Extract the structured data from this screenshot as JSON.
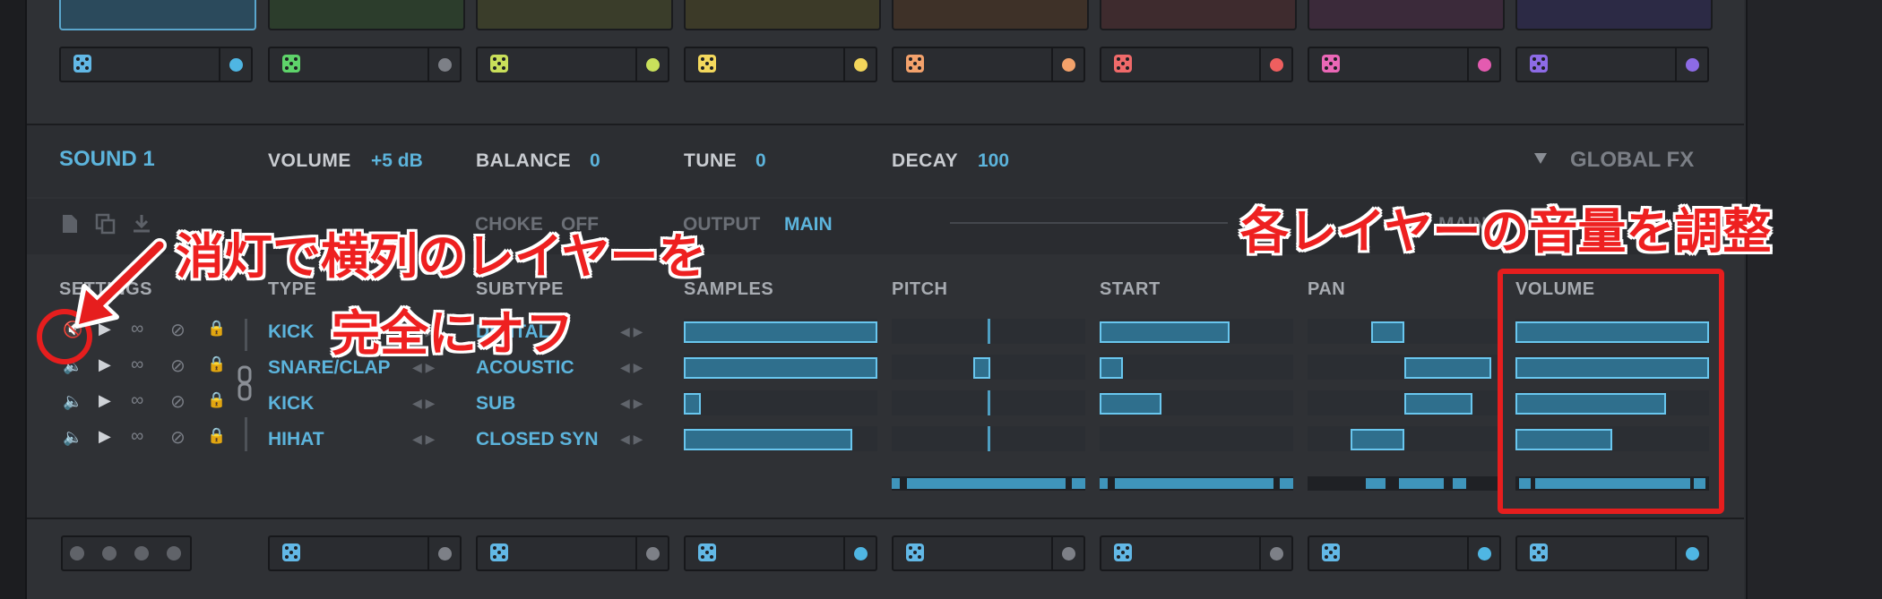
{
  "pads": {
    "top_colors": [
      "#2b4a5c",
      "#2c3d2c",
      "#3a3d2a",
      "#3c3a28",
      "#3e3128",
      "#3e2b2e",
      "#3b2a3a",
      "#2c2a45"
    ],
    "slots": [
      {
        "face": "#62b8e6",
        "dot": "#4fb6e3"
      },
      {
        "face": "#5ed36a",
        "dot": "#7d8087"
      },
      {
        "face": "#c9df5a",
        "dot": "#c9e05b"
      },
      {
        "face": "#f3d85d",
        "dot": "#f2d55b"
      },
      {
        "face": "#f3a26c",
        "dot": "#f3a26b"
      },
      {
        "face": "#ef6a6a",
        "dot": "#ef5f5f"
      },
      {
        "face": "#ea67b6",
        "dot": "#e45bb0"
      },
      {
        "face": "#8d6be6",
        "dot": "#8d6be6"
      }
    ]
  },
  "sound_header": {
    "name": "SOUND 1",
    "volume_label": "VOLUME",
    "volume_value": "+5 dB",
    "balance_label": "BALANCE",
    "balance_value": "0",
    "tune_label": "TUNE",
    "tune_value": "0",
    "decay_label": "DECAY",
    "decay_value": "100",
    "global_fx": "GLOBAL FX",
    "global_fx_icon": "triangle-down-icon"
  },
  "toolbar": {
    "choke_label": "CHOKE",
    "choke_value": "OFF",
    "output_label": "OUTPUT",
    "output_value": "MAIN",
    "right_label": "MAIN"
  },
  "columns": {
    "settings": "SETTINGS",
    "type": "TYPE",
    "subtype": "SUBTYPE",
    "samples": "SAMPLES",
    "pitch": "PITCH",
    "start": "START",
    "pan": "PAN",
    "volume": "VOLUME"
  },
  "layers": [
    {
      "type": "KICK",
      "subtype": "DIGITAL",
      "muted": true,
      "samples": 1.0,
      "pitch": 0.5,
      "start": 0.67,
      "pan": [
        0.33,
        0.5
      ],
      "volume": 1.0
    },
    {
      "type": "SNARE/CLAP",
      "subtype": "ACOUSTIC",
      "muted": false,
      "samples": 1.0,
      "pitch": 0.42,
      "start": 0.12,
      "pan": [
        0.5,
        0.95
      ],
      "volume": 1.0
    },
    {
      "type": "KICK",
      "subtype": "SUB",
      "muted": false,
      "samples": 0.09,
      "pitch": 0.5,
      "start": 0.32,
      "pan": [
        0.5,
        0.85
      ],
      "volume": 0.78
    },
    {
      "type": "HIHAT",
      "subtype": "CLOSED SYN",
      "muted": false,
      "samples": 0.87,
      "pitch": 0.5,
      "start": 0.0,
      "pan": [
        0.22,
        0.5
      ],
      "volume": 0.5
    }
  ],
  "bottom": {
    "slot_dots": [
      "#7d8087",
      "#7d8087",
      "#4fb6e3",
      "#7d8087",
      "#7d8087",
      "#4fb6e3",
      "#4fb6e3"
    ]
  },
  "annotations": {
    "left_line1": "消灯で横列のレイヤーを",
    "left_line2": "完全にオフ",
    "right": "各レイヤーの音量を調整",
    "color": "#e61e1e"
  }
}
